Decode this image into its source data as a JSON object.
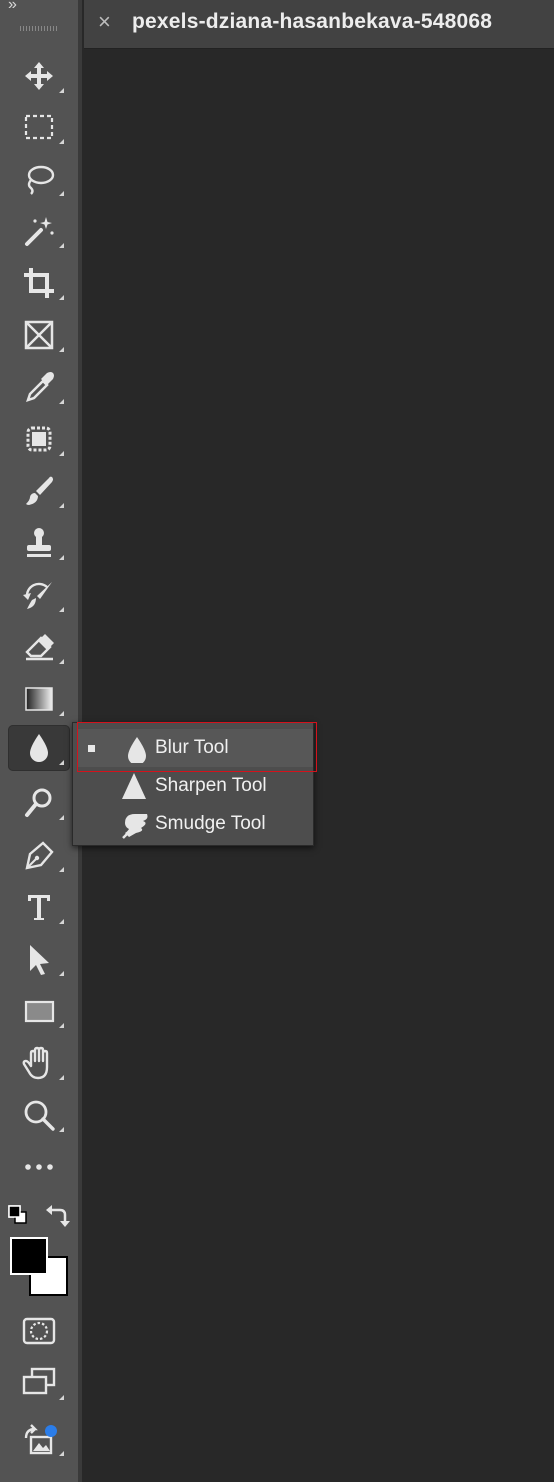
{
  "document": {
    "close_glyph": "×",
    "tab_title": "pexels-dziana-hasanbekava-548068"
  },
  "toolbar": {
    "collapse_glyph": "»",
    "tools": [
      {
        "name": "move-tool",
        "icon": "move-icon",
        "active": false
      },
      {
        "name": "marquee-tool",
        "icon": "rectangular-marquee-icon",
        "active": false
      },
      {
        "name": "lasso-tool",
        "icon": "lasso-icon",
        "active": false
      },
      {
        "name": "magic-wand-tool",
        "icon": "magic-wand-icon",
        "active": false
      },
      {
        "name": "crop-tool",
        "icon": "crop-icon",
        "active": false
      },
      {
        "name": "frame-tool",
        "icon": "frame-icon",
        "active": false
      },
      {
        "name": "eyedropper-tool",
        "icon": "eyedropper-icon",
        "active": false
      },
      {
        "name": "healing-brush-tool",
        "icon": "spot-healing-icon",
        "active": false
      },
      {
        "name": "brush-tool",
        "icon": "brush-icon",
        "active": false
      },
      {
        "name": "clone-stamp-tool",
        "icon": "stamp-icon",
        "active": false
      },
      {
        "name": "history-brush-tool",
        "icon": "history-brush-icon",
        "active": false
      },
      {
        "name": "eraser-tool",
        "icon": "eraser-icon",
        "active": false
      },
      {
        "name": "gradient-tool",
        "icon": "gradient-icon",
        "active": false
      },
      {
        "name": "blur-tool",
        "icon": "blur-drop-icon",
        "active": true
      },
      {
        "name": "dodge-tool",
        "icon": "dodge-icon",
        "active": false
      },
      {
        "name": "pen-tool",
        "icon": "pen-icon",
        "active": false
      },
      {
        "name": "type-tool",
        "icon": "type-icon",
        "active": false
      },
      {
        "name": "path-selection-tool",
        "icon": "arrow-pointer-icon",
        "active": false
      },
      {
        "name": "rectangle-tool",
        "icon": "rectangle-icon",
        "active": false
      },
      {
        "name": "hand-tool",
        "icon": "hand-icon",
        "active": false
      },
      {
        "name": "zoom-tool",
        "icon": "zoom-icon",
        "active": false
      },
      {
        "name": "edit-toolbar",
        "icon": "more-icon",
        "active": false
      }
    ],
    "colors": {
      "foreground": "#000000",
      "background": "#ffffff"
    },
    "bottom_tools": [
      {
        "name": "quick-mask-button",
        "icon": "quick-mask-icon"
      },
      {
        "name": "screen-mode-button",
        "icon": "screen-mode-icon"
      },
      {
        "name": "content-credentials-button",
        "icon": "share-image-icon"
      }
    ]
  },
  "flyout": {
    "items": [
      {
        "label": "Blur Tool",
        "icon": "blur-drop-icon",
        "selected": true
      },
      {
        "label": "Sharpen Tool",
        "icon": "sharpen-triangle-icon",
        "selected": false
      },
      {
        "label": "Smudge Tool",
        "icon": "smudge-finger-icon",
        "selected": false
      }
    ]
  },
  "colors": {
    "toolbar_bg": "#535353",
    "canvas_bg": "#282828",
    "highlight_border": "#d4121c",
    "icon_color": "#e6e6e6"
  }
}
